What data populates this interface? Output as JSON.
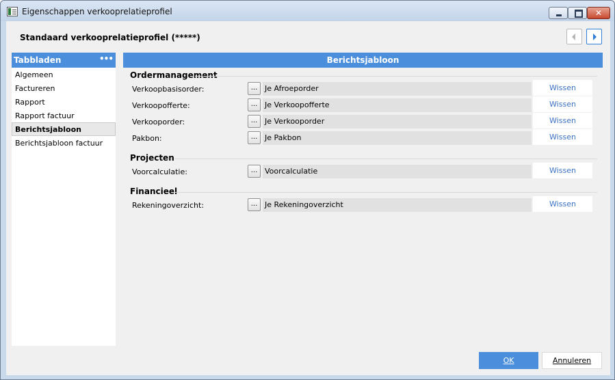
{
  "window": {
    "title": "Eigenschappen verkooprelatieprofiel",
    "minimize_icon": "minimize-icon",
    "maximize_icon": "maximize-icon",
    "close_icon": "close-icon"
  },
  "header": {
    "title": "Standaard verkooprelatieprofiel (*****)",
    "prev_icon": "chevron-left-icon",
    "next_icon": "chevron-right-icon"
  },
  "sidebar": {
    "title": "Tabbladen",
    "more_label": "•••",
    "items": [
      {
        "label": "Algemeen",
        "selected": false
      },
      {
        "label": "Factureren",
        "selected": false
      },
      {
        "label": "Rapport",
        "selected": false
      },
      {
        "label": "Rapport factuur",
        "selected": false
      },
      {
        "label": "Berichtsjabloon",
        "selected": true
      },
      {
        "label": "Berichtsjabloon factuur",
        "selected": false
      }
    ]
  },
  "main": {
    "title": "Berichtsjabloon",
    "browse_label": "...",
    "clear_label": "Wissen",
    "sections": [
      {
        "title": "Ordermanagement",
        "fields": [
          {
            "label": "Verkoopbasisorder:",
            "value": "Je Afroeporder"
          },
          {
            "label": "Verkoopofferte:",
            "value": "Je Verkoopofferte"
          },
          {
            "label": "Verkooporder:",
            "value": "Je Verkooporder"
          },
          {
            "label": "Pakbon:",
            "value": "Je Pakbon"
          }
        ]
      },
      {
        "title": "Projecten",
        "fields": [
          {
            "label": "Voorcalculatie:",
            "value": "Voorcalculatie"
          }
        ]
      },
      {
        "title": "Financieel",
        "fields": [
          {
            "label": "Rekeningoverzicht:",
            "value": "Je Rekeningoverzicht"
          }
        ]
      }
    ]
  },
  "footer": {
    "ok_label": "OK",
    "cancel_label": "Annuleren"
  },
  "colors": {
    "accent": "#4b8fdc",
    "link": "#3a72c4"
  }
}
